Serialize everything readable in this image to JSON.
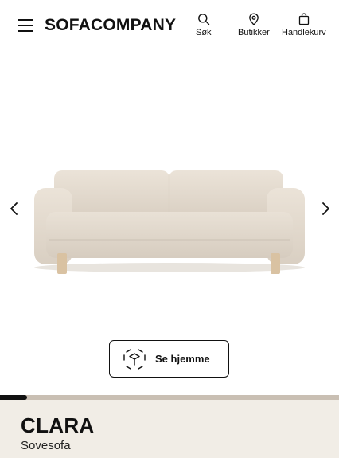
{
  "header": {
    "logo": "SOFACOMPANY",
    "nav": {
      "search_label": "Søk",
      "stores_label": "Butikker",
      "cart_label": "Handlekurv"
    }
  },
  "gallery": {
    "progress_fraction": 0.08,
    "ar_button_label": "Se hjemme"
  },
  "product": {
    "name": "CLARA",
    "type": "Sovesofa"
  },
  "colors": {
    "info_bg": "#f1ede6",
    "progress_track": "#c9bfb3",
    "progress_fill": "#111111",
    "sofa_fabric": "#e6ddd1"
  }
}
